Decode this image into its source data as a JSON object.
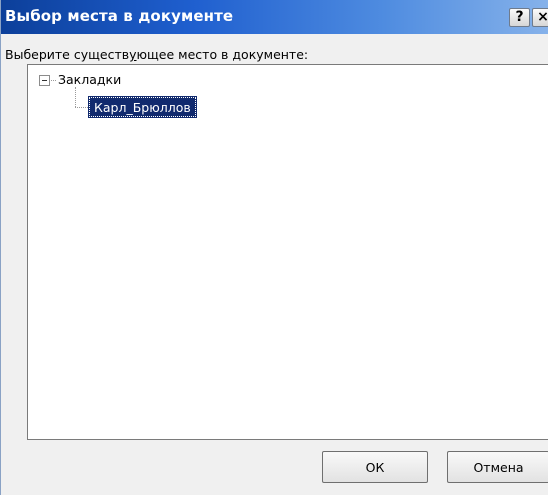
{
  "window": {
    "title": "Выбор места в документе",
    "help_label": "?",
    "close_label": "×"
  },
  "instruction": {
    "before": "Выберите существ",
    "underlined": "у",
    "after": "ющее место в документе:"
  },
  "tree": {
    "root_label": "Закладки",
    "root_expanded": true,
    "children": [
      {
        "label": "Карл_Брюллов",
        "selected": true
      }
    ]
  },
  "buttons": {
    "ok_label": "ОК",
    "cancel_label": "Отмена"
  },
  "colors": {
    "selection": "#112a6e",
    "title_start": "#0c3f9a",
    "title_end": "#86b2ea"
  }
}
